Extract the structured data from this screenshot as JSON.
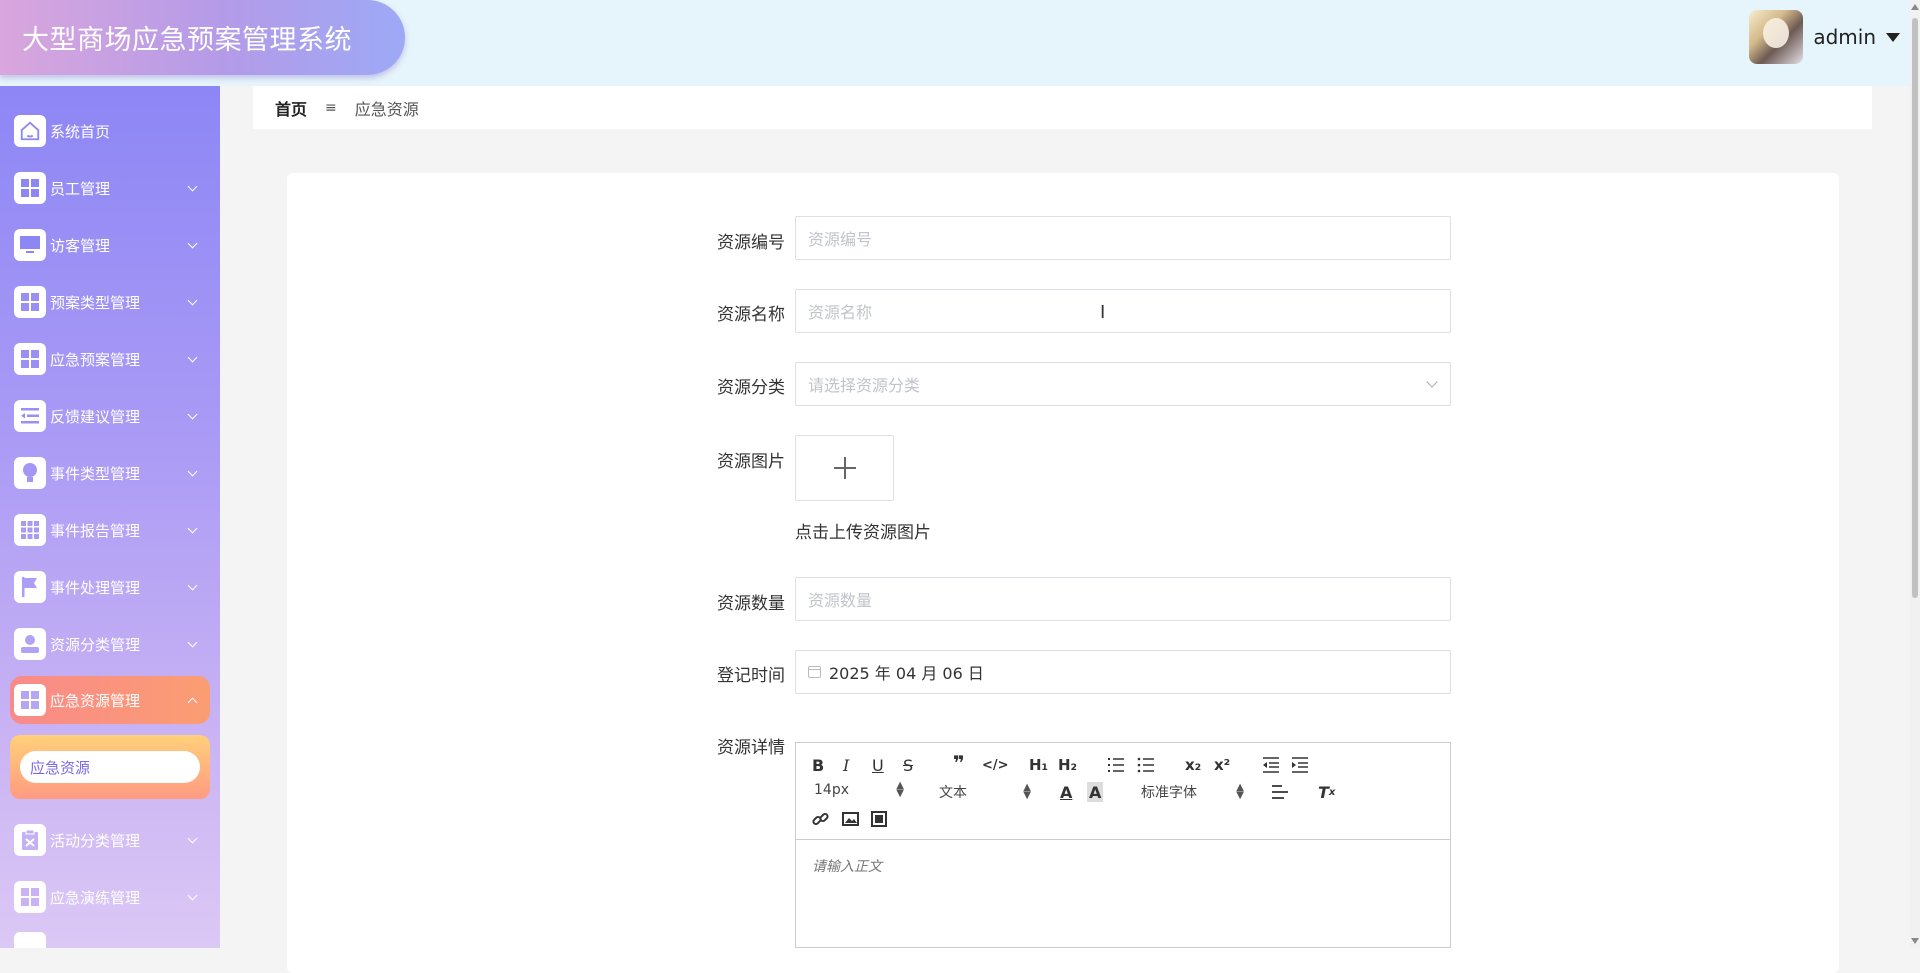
{
  "header": {
    "title": "大型商场应急预案管理系统",
    "username": "admin"
  },
  "sidebar": {
    "items": [
      {
        "label": "系统首页",
        "icon": "home-icon"
      },
      {
        "label": "员工管理",
        "icon": "grid-icon"
      },
      {
        "label": "访客管理",
        "icon": "monitor-icon"
      },
      {
        "label": "预案类型管理",
        "icon": "grid-icon"
      },
      {
        "label": "应急预案管理",
        "icon": "grid-icon"
      },
      {
        "label": "反馈建议管理",
        "icon": "list-icon"
      },
      {
        "label": "事件类型管理",
        "icon": "bulb-icon"
      },
      {
        "label": "事件报告管理",
        "icon": "grid9-icon"
      },
      {
        "label": "事件处理管理",
        "icon": "flag-icon"
      },
      {
        "label": "资源分类管理",
        "icon": "user-icon"
      },
      {
        "label": "应急资源管理",
        "icon": "grid-icon"
      },
      {
        "label": "活动分类管理",
        "icon": "clipboard-icon"
      },
      {
        "label": "应急演练管理",
        "icon": "grid-icon"
      }
    ],
    "submenu_item": "应急资源"
  },
  "breadcrumb": {
    "home": "首页",
    "separator": "≡",
    "current": "应急资源"
  },
  "form": {
    "code_label": "资源编号",
    "code_placeholder": "资源编号",
    "name_label": "资源名称",
    "name_placeholder": "资源名称",
    "category_label": "资源分类",
    "category_placeholder": "请选择资源分类",
    "image_label": "资源图片",
    "image_hint": "点击上传资源图片",
    "qty_label": "资源数量",
    "qty_placeholder": "资源数量",
    "date_label": "登记时间",
    "date_value": "2025 年 04 月 06 日",
    "detail_label": "资源详情"
  },
  "editor": {
    "font_size": "14px",
    "heading": "文本",
    "font_family": "标准字体",
    "placeholder": "请输入正文"
  },
  "colors": {
    "sidebar_top": "#8d86f5",
    "sidebar_bottom": "#dcc8f5",
    "active_item": "#f98a8a",
    "submenu_bg": "#ffd07a",
    "header_bg": "#e6f4fb"
  }
}
